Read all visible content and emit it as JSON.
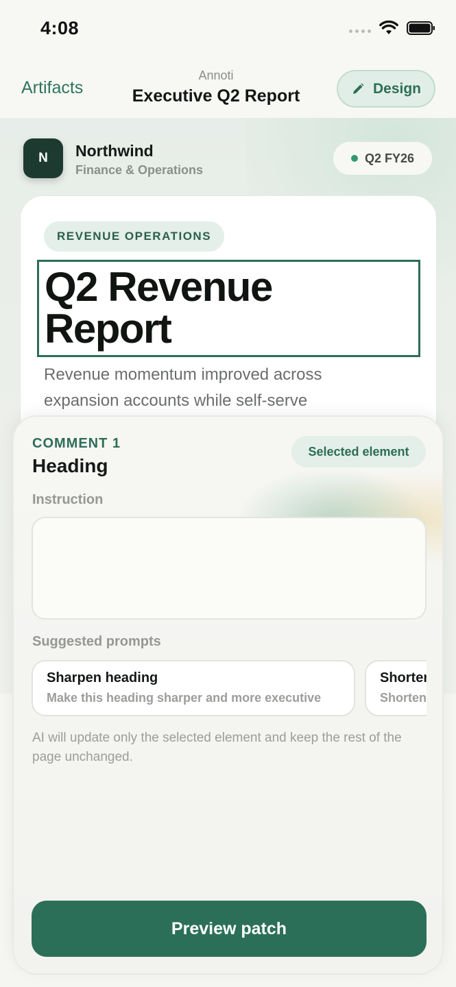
{
  "status_bar": {
    "time": "4:08"
  },
  "nav": {
    "back_label": "Artifacts",
    "app_name": "Annoti",
    "title": "Executive Q2 Report",
    "design_label": "Design"
  },
  "org": {
    "initial": "N",
    "name": "Northwind",
    "subtitle": "Finance & Operations",
    "period": "Q2 FY26"
  },
  "report": {
    "section_label": "REVENUE OPERATIONS",
    "heading": "Q2 Revenue Report",
    "summary": "Revenue momentum improved across expansion accounts while self-serve"
  },
  "comment": {
    "label": "COMMENT 1",
    "element": "Heading",
    "selected_badge": "Selected element",
    "instruction_label": "Instruction",
    "instruction_value": "",
    "suggested_label": "Suggested prompts",
    "prompts": [
      {
        "title": "Sharpen heading",
        "description": "Make this heading sharper and more executive"
      },
      {
        "title": "Shorten",
        "description": "Shorten"
      }
    ],
    "disclaimer": "AI will update only the selected element and keep the rest of the page unchanged.",
    "preview_label": "Preview patch"
  },
  "colors": {
    "accent": "#2c6f59",
    "accent_light": "#e3efe8",
    "status_dot": "#2f9a6e",
    "logo_bg": "#1d3a30"
  }
}
